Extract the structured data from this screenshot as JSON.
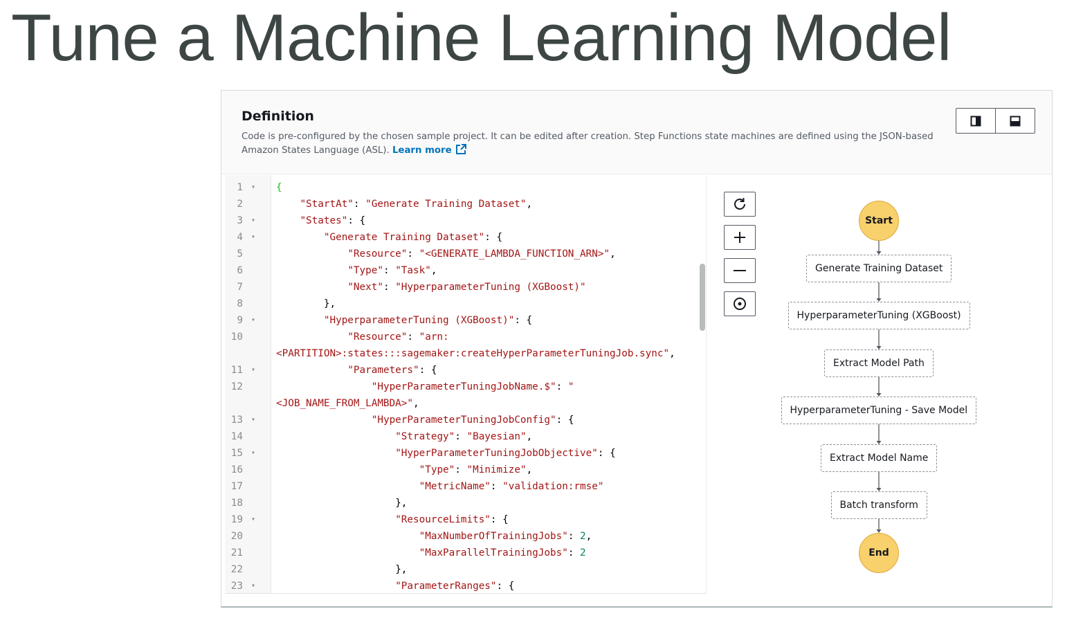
{
  "page": {
    "title": "Tune a Machine Learning Model"
  },
  "definition": {
    "title": "Definition",
    "description": "Code is pre-configured by the chosen sample project. It can be edited after creation. Step Functions state machines are defined using the JSON-based Amazon States Language (ASL).",
    "learn_more": "Learn more",
    "layout_icons": [
      "split-vertical-icon",
      "split-horizontal-icon"
    ]
  },
  "editor": {
    "lines": [
      {
        "n": "1",
        "fold": true,
        "text": "{"
      },
      {
        "n": "2",
        "fold": false,
        "text": "    \"StartAt\": \"Generate Training Dataset\","
      },
      {
        "n": "3",
        "fold": true,
        "text": "    \"States\": {"
      },
      {
        "n": "4",
        "fold": true,
        "text": "        \"Generate Training Dataset\": {"
      },
      {
        "n": "5",
        "fold": false,
        "text": "            \"Resource\": \"<GENERATE_LAMBDA_FUNCTION_ARN>\","
      },
      {
        "n": "6",
        "fold": false,
        "text": "            \"Type\": \"Task\","
      },
      {
        "n": "7",
        "fold": false,
        "text": "            \"Next\": \"HyperparameterTuning (XGBoost)\""
      },
      {
        "n": "8",
        "fold": false,
        "text": "        },"
      },
      {
        "n": "9",
        "fold": true,
        "text": "        \"HyperparameterTuning (XGBoost)\": {"
      },
      {
        "n": "10",
        "fold": false,
        "text": "            \"Resource\": \"arn:"
      },
      {
        "n": "",
        "fold": false,
        "text": "<PARTITION>:states:::sagemaker:createHyperParameterTuningJob.sync\","
      },
      {
        "n": "11",
        "fold": true,
        "text": "            \"Parameters\": {"
      },
      {
        "n": "12",
        "fold": false,
        "text": "                \"HyperParameterTuningJobName.$\": \""
      },
      {
        "n": "",
        "fold": false,
        "text": "<JOB_NAME_FROM_LAMBDA>\","
      },
      {
        "n": "13",
        "fold": true,
        "text": "                \"HyperParameterTuningJobConfig\": {"
      },
      {
        "n": "14",
        "fold": false,
        "text": "                    \"Strategy\": \"Bayesian\","
      },
      {
        "n": "15",
        "fold": true,
        "text": "                    \"HyperParameterTuningJobObjective\": {"
      },
      {
        "n": "16",
        "fold": false,
        "text": "                        \"Type\": \"Minimize\","
      },
      {
        "n": "17",
        "fold": false,
        "text": "                        \"MetricName\": \"validation:rmse\""
      },
      {
        "n": "18",
        "fold": false,
        "text": "                    },"
      },
      {
        "n": "19",
        "fold": true,
        "text": "                    \"ResourceLimits\": {"
      },
      {
        "n": "20",
        "fold": false,
        "text": "                        \"MaxNumberOfTrainingJobs\": 2,"
      },
      {
        "n": "21",
        "fold": false,
        "text": "                        \"MaxParallelTrainingJobs\": 2"
      },
      {
        "n": "22",
        "fold": false,
        "text": "                    },"
      },
      {
        "n": "23",
        "fold": true,
        "text": "                    \"ParameterRanges\": {"
      }
    ]
  },
  "graph": {
    "controls": [
      "refresh-icon",
      "zoom-in-icon",
      "zoom-out-icon",
      "center-icon"
    ],
    "start": "Start",
    "end": "End",
    "states": [
      "Generate Training Dataset",
      "HyperparameterTuning (XGBoost)",
      "Extract Model Path",
      "HyperparameterTuning - Save Model",
      "Extract Model Name",
      "Batch transform"
    ]
  }
}
